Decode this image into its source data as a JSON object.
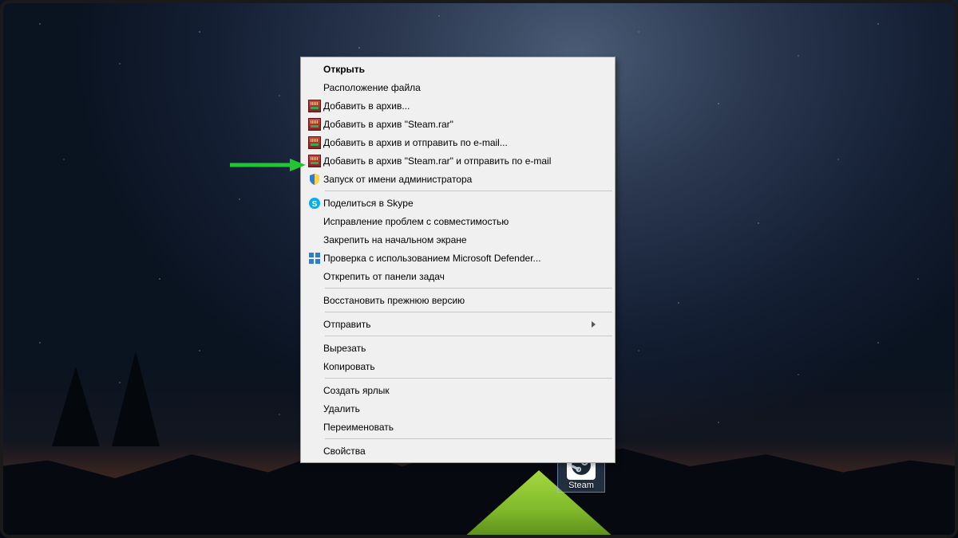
{
  "desktop_icon": {
    "label": "Steam"
  },
  "context_menu": {
    "items": [
      {
        "label": "Открыть",
        "icon": null,
        "bold": true
      },
      {
        "label": "Расположение файла",
        "icon": null
      },
      {
        "label": "Добавить в архив...",
        "icon": "rar"
      },
      {
        "label": "Добавить в архив \"Steam.rar\"",
        "icon": "rar"
      },
      {
        "label": "Добавить в архив и отправить по e-mail...",
        "icon": "rar"
      },
      {
        "label": "Добавить в архив \"Steam.rar\" и отправить по e-mail",
        "icon": "rar"
      },
      {
        "label": "Запуск от имени администратора",
        "icon": "shield",
        "highlighted": true
      },
      {
        "sep": true
      },
      {
        "label": "Поделиться в Skype",
        "icon": "skype"
      },
      {
        "label": "Исправление проблем с совместимостью",
        "icon": null
      },
      {
        "label": "Закрепить на начальном экране",
        "icon": null
      },
      {
        "label": "Проверка с использованием Microsoft Defender...",
        "icon": "defender"
      },
      {
        "label": "Открепить от панели задач",
        "icon": null
      },
      {
        "sep": true
      },
      {
        "label": "Восстановить прежнюю версию",
        "icon": null
      },
      {
        "sep": true
      },
      {
        "label": "Отправить",
        "icon": null,
        "submenu": true
      },
      {
        "sep": true
      },
      {
        "label": "Вырезать",
        "icon": null
      },
      {
        "label": "Копировать",
        "icon": null
      },
      {
        "sep": true
      },
      {
        "label": "Создать ярлык",
        "icon": null
      },
      {
        "label": "Удалить",
        "icon": null
      },
      {
        "label": "Переименовать",
        "icon": null
      },
      {
        "sep": true
      },
      {
        "label": "Свойства",
        "icon": null
      }
    ]
  }
}
